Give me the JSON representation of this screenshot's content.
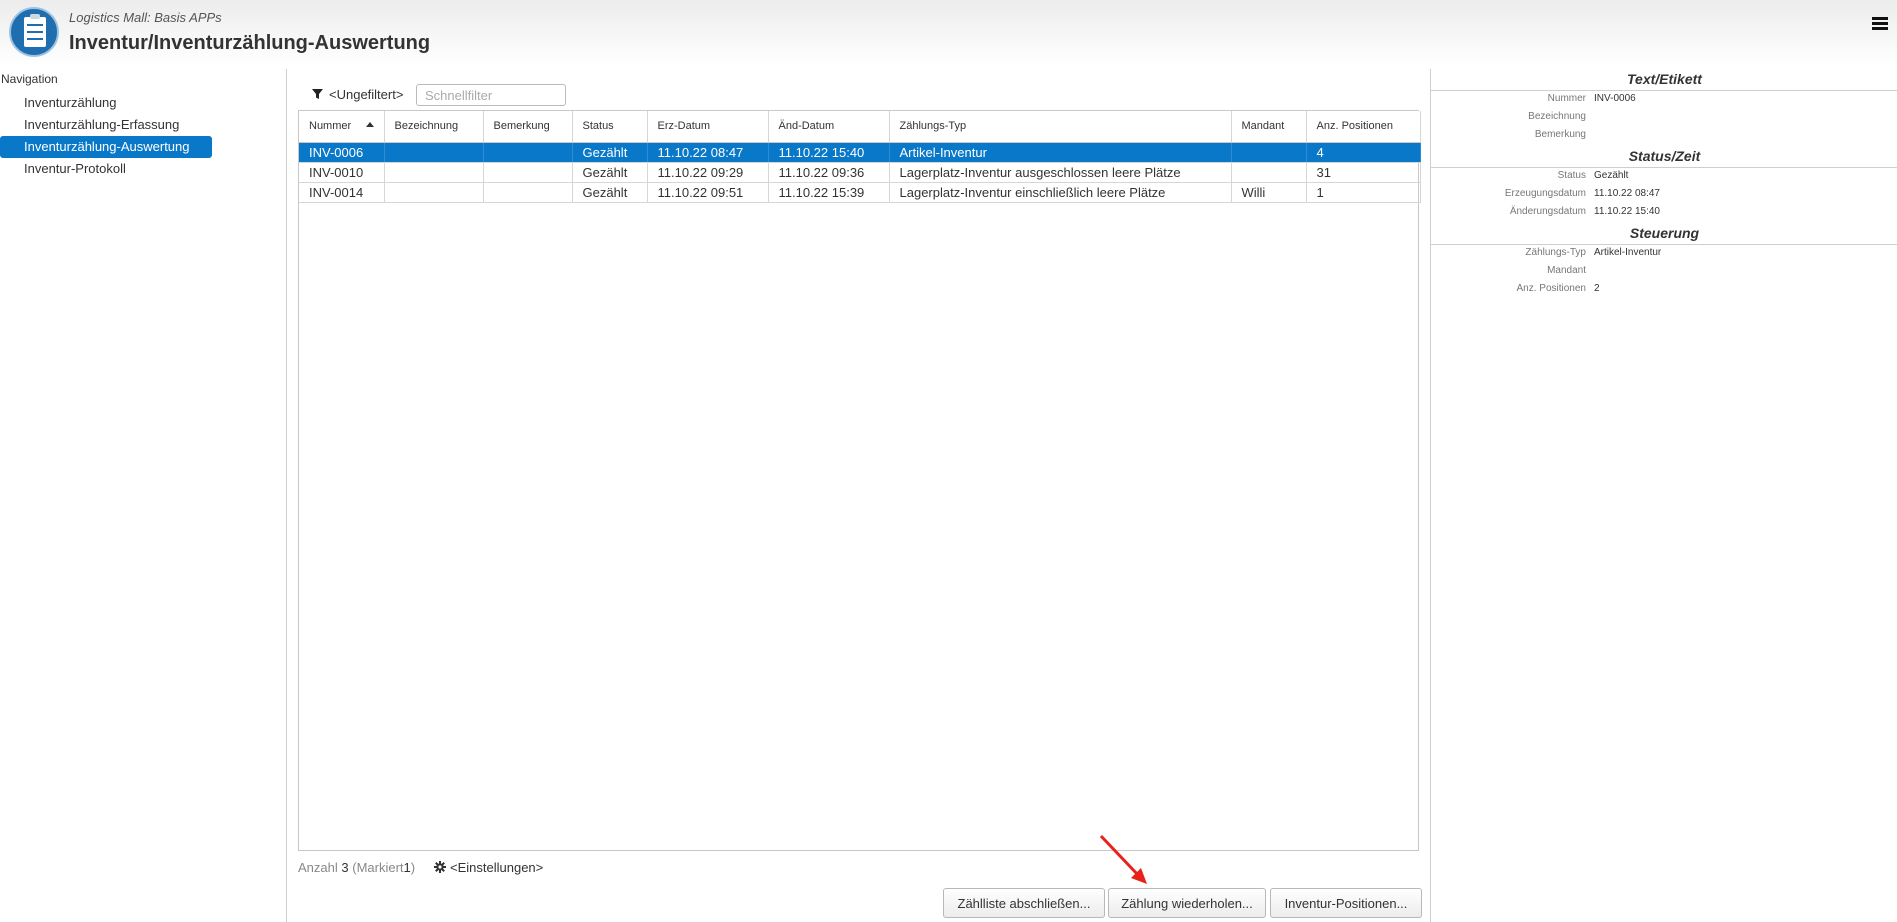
{
  "header": {
    "subtitle": "Logistics Mall: Basis APPs",
    "title": "Inventur/Inventurzählung-Auswertung",
    "app_icon": "clipboard-checklist-icon",
    "menu_icon": "hamburger-menu-icon"
  },
  "sidebar": {
    "heading": "Navigation",
    "items": [
      {
        "label": "Inventurzählung"
      },
      {
        "label": "Inventurzählung-Erfassung"
      },
      {
        "label": "Inventurzählung-Auswertung",
        "active": true
      },
      {
        "label": "Inventur-Protokoll"
      }
    ]
  },
  "filter": {
    "icon": "filter-icon",
    "label": "<Ungefiltert>",
    "placeholder": "Schnellfilter"
  },
  "table": {
    "columns": [
      "Nummer",
      "Bezeichnung",
      "Bemerkung",
      "Status",
      "Erz-Datum",
      "Änd-Datum",
      "Zählungs-Typ",
      "Mandant",
      "Anz. Positionen"
    ],
    "sort_column": "Nummer",
    "rows": [
      {
        "nummer": "INV-0006",
        "bezeichnung": "",
        "bemerkung": "",
        "status": "Gezählt",
        "erz": "11.10.22 08:47",
        "aend": "11.10.22 15:40",
        "typ": "Artikel-Inventur",
        "mandant": "",
        "anz": "4",
        "selected": true
      },
      {
        "nummer": "INV-0010",
        "bezeichnung": "",
        "bemerkung": "",
        "status": "Gezählt",
        "erz": "11.10.22 09:29",
        "aend": "11.10.22 09:36",
        "typ": "Lagerplatz-Inventur ausgeschlossen leere Plätze",
        "mandant": "",
        "anz": "31"
      },
      {
        "nummer": "INV-0014",
        "bezeichnung": "",
        "bemerkung": "",
        "status": "Gezählt",
        "erz": "11.10.22 09:51",
        "aend": "11.10.22 15:39",
        "typ": "Lagerplatz-Inventur einschließlich leere Plätze",
        "mandant": "Willi",
        "anz": "1"
      }
    ]
  },
  "footer": {
    "count_label": "Anzahl",
    "count": "3",
    "marked_open": "(Markiert",
    "marked": "1",
    "marked_close": ")",
    "settings_label": "<Einstellungen>",
    "settings_icon": "gear-icon"
  },
  "buttons": {
    "close_list": "Zählliste abschließen...",
    "repeat_count": "Zählung wiederholen...",
    "positions": "Inventur-Positionen..."
  },
  "annotation": {
    "arrow_color": "#e8211b"
  },
  "detail": {
    "sections": [
      {
        "title": "Text/Etikett",
        "fields": [
          {
            "label": "Nummer",
            "value": "INV-0006"
          },
          {
            "label": "Bezeichnung",
            "value": ""
          },
          {
            "label": "Bemerkung",
            "value": ""
          }
        ]
      },
      {
        "title": "Status/Zeit",
        "fields": [
          {
            "label": "Status",
            "value": "Gezählt"
          },
          {
            "label": "Erzeugungsdatum",
            "value": "11.10.22 08:47"
          },
          {
            "label": "Änderungsdatum",
            "value": "11.10.22 15:40"
          }
        ]
      },
      {
        "title": "Steuerung",
        "fields": [
          {
            "label": "Zählungs-Typ",
            "value": "Artikel-Inventur"
          },
          {
            "label": "Mandant",
            "value": ""
          },
          {
            "label": "Anz. Positionen",
            "value": "2"
          }
        ]
      }
    ]
  },
  "colors": {
    "accent": "#0a78c8"
  }
}
